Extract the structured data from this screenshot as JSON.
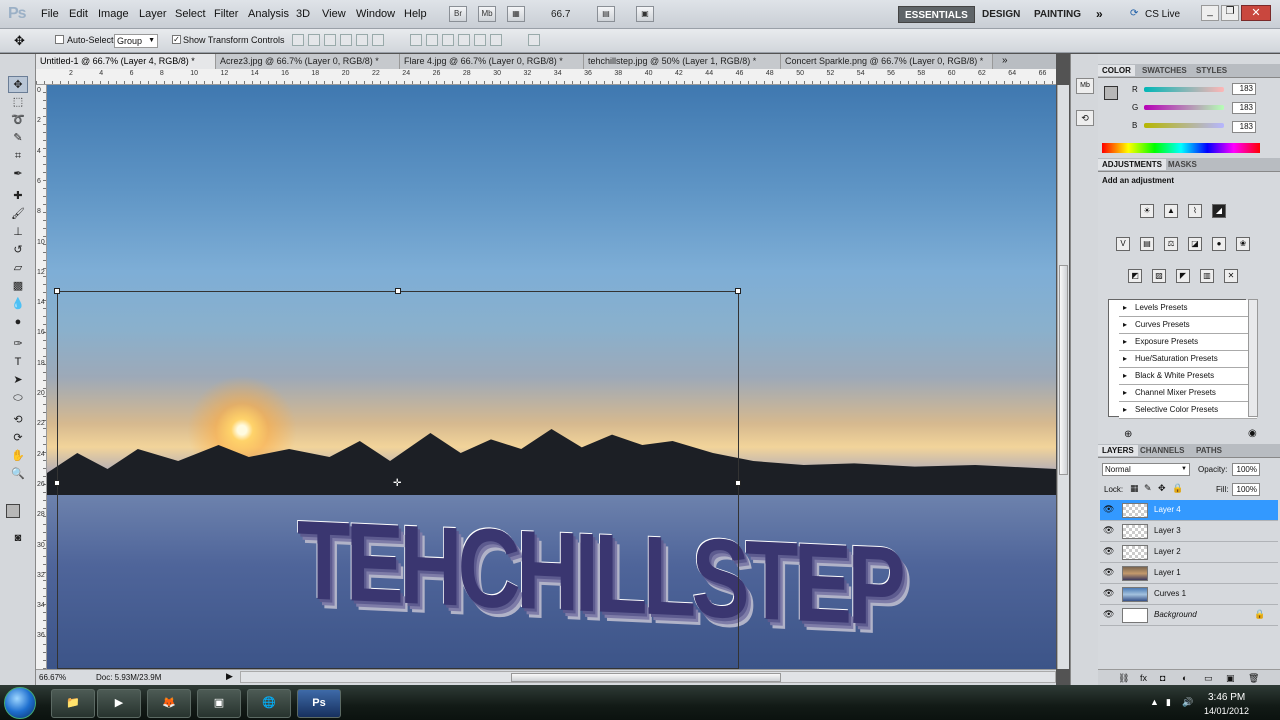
{
  "app": {
    "logo": "Ps"
  },
  "menu": [
    "File",
    "Edit",
    "Image",
    "Layer",
    "Select",
    "Filter",
    "Analysis",
    "3D",
    "View",
    "Window",
    "Help"
  ],
  "toolbar": {
    "br": "Br",
    "mb": "Mb",
    "zoom": "66.7"
  },
  "workspaces": [
    "ESSENTIALS",
    "DESIGN",
    "PAINTING"
  ],
  "cs_live": "CS Live",
  "options": {
    "auto_select": "Auto-Select:",
    "group": "Group",
    "show_transform": "Show Transform Controls"
  },
  "tabs": [
    {
      "label": "Untitled-1 @ 66.7% (Layer 4, RGB/8) *",
      "active": true
    },
    {
      "label": "Acrez3.jpg @ 66.7% (Layer 0, RGB/8) *",
      "active": false
    },
    {
      "label": "Flare 4.jpg @ 66.7% (Layer 0, RGB/8) *",
      "active": false
    },
    {
      "label": "tehchillstep.jpg @ 50% (Layer 1, RGB/8) *",
      "active": false
    },
    {
      "label": "Concert Sparkle.png @ 66.7% (Layer 0, RGB/8) *",
      "active": false
    }
  ],
  "ruler_top": [
    "2",
    "4",
    "6",
    "8",
    "10",
    "12",
    "14",
    "16",
    "18",
    "20",
    "22",
    "24",
    "26",
    "28",
    "30",
    "32",
    "34",
    "36",
    "38",
    "40",
    "42",
    "44",
    "46",
    "48",
    "50",
    "52",
    "54",
    "56",
    "58",
    "60",
    "62",
    "64",
    "66"
  ],
  "ruler_left": [
    "0",
    "2",
    "4",
    "6",
    "8",
    "10",
    "12",
    "14",
    "16",
    "18",
    "20",
    "22",
    "24",
    "26",
    "28",
    "30",
    "32",
    "34",
    "36"
  ],
  "canvas": {
    "art_text": "TEHCHILLSTEP"
  },
  "status": {
    "zoom": "66.67%",
    "doc": "Doc: 5.93M/23.9M"
  },
  "color_panel": {
    "tabs": [
      "COLOR",
      "SWATCHES",
      "STYLES"
    ],
    "channels": [
      {
        "name": "R",
        "value": "183"
      },
      {
        "name": "G",
        "value": "183"
      },
      {
        "name": "B",
        "value": "183"
      }
    ]
  },
  "adjustments": {
    "tabs": [
      "ADJUSTMENTS",
      "MASKS"
    ],
    "title": "Add an adjustment",
    "presets": [
      "Levels Presets",
      "Curves Presets",
      "Exposure Presets",
      "Hue/Saturation Presets",
      "Black & White Presets",
      "Channel Mixer Presets",
      "Selective Color Presets"
    ]
  },
  "layers_panel": {
    "tabs": [
      "LAYERS",
      "CHANNELS",
      "PATHS"
    ],
    "blend": "Normal",
    "opacity_label": "Opacity:",
    "opacity": "100%",
    "lock_label": "Lock:",
    "fill_label": "Fill:",
    "fill": "100%",
    "layers": [
      {
        "name": "Layer 4",
        "selected": true
      },
      {
        "name": "Layer 3",
        "selected": false
      },
      {
        "name": "Layer 2",
        "selected": false
      },
      {
        "name": "Layer 1",
        "selected": false
      },
      {
        "name": "Curves 1",
        "selected": false
      },
      {
        "name": "Background",
        "selected": false
      }
    ]
  },
  "taskbar": {
    "ps_label": "Ps",
    "time": "3:46 PM",
    "date": "14/01/2012"
  }
}
